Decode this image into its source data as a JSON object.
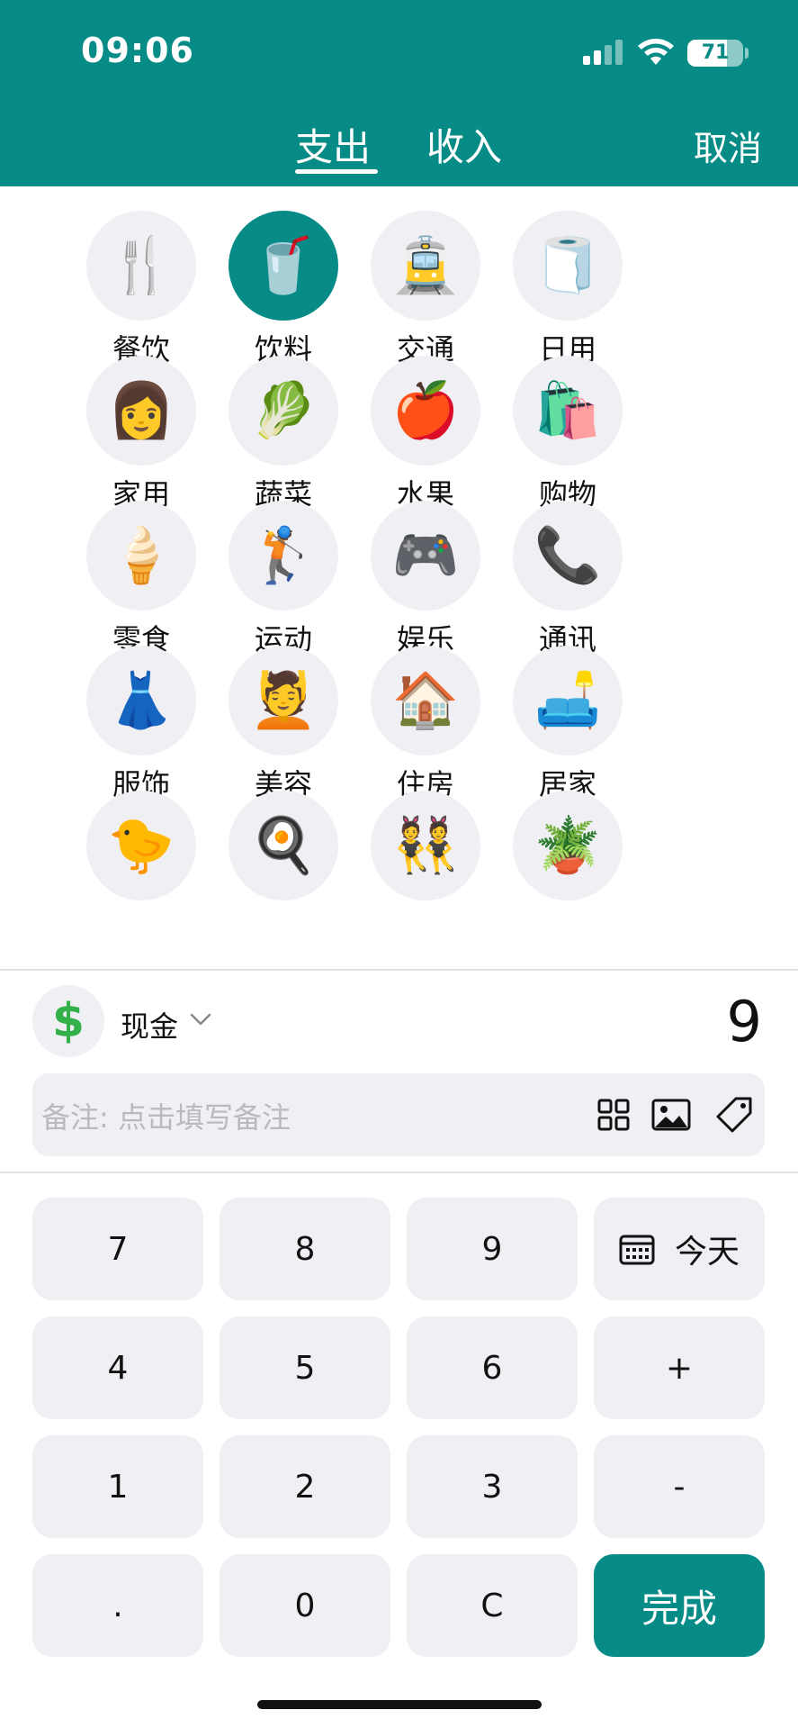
{
  "status_bar": {
    "time": "09:06",
    "battery": "71",
    "battery_level": 0.71
  },
  "header": {
    "tabs": [
      {
        "label": "支出",
        "selected": true
      },
      {
        "label": "收入",
        "selected": false
      }
    ],
    "cancel_label": "取消",
    "color": "#068b86"
  },
  "categories": [
    {
      "label": "餐饮",
      "icon": "fork-and-knife-icon",
      "glyph": "🍴",
      "selected": false
    },
    {
      "label": "饮料",
      "icon": "cup-with-straw-icon",
      "glyph": "🥤",
      "selected": true
    },
    {
      "label": "交通",
      "icon": "tram-icon",
      "glyph": "🚊",
      "selected": false
    },
    {
      "label": "日用",
      "icon": "toilet-paper-icon",
      "glyph": "🧻",
      "selected": false
    },
    {
      "label": "家用",
      "icon": "woman-icon",
      "glyph": "👩",
      "selected": false
    },
    {
      "label": "蔬菜",
      "icon": "leafy-green-icon",
      "glyph": "🥬",
      "selected": false
    },
    {
      "label": "水果",
      "icon": "apple-icon",
      "glyph": "🍎",
      "selected": false
    },
    {
      "label": "购物",
      "icon": "shopping-bags-icon",
      "glyph": "🛍️",
      "selected": false
    },
    {
      "label": "零食",
      "icon": "ice-cream-icon",
      "glyph": "🍦",
      "selected": false
    },
    {
      "label": "运动",
      "icon": "golfer-icon",
      "glyph": "🏌️",
      "selected": false
    },
    {
      "label": "娱乐",
      "icon": "game-controller-icon",
      "glyph": "🎮",
      "selected": false
    },
    {
      "label": "通讯",
      "icon": "telephone-icon",
      "glyph": "📞",
      "selected": false
    },
    {
      "label": "服饰",
      "icon": "dress-icon",
      "glyph": "👗",
      "selected": false
    },
    {
      "label": "美容",
      "icon": "face-massage-icon",
      "glyph": "💆",
      "selected": false
    },
    {
      "label": "住房",
      "icon": "house-icon",
      "glyph": "🏠",
      "selected": false
    },
    {
      "label": "居家",
      "icon": "couch-and-lamp-icon",
      "glyph": "🛋️",
      "selected": false
    },
    {
      "label": "",
      "icon": "partially-hidden-icon",
      "glyph": "🐤",
      "selected": false
    },
    {
      "label": "",
      "icon": "partially-hidden-icon",
      "glyph": "🍳",
      "selected": false
    },
    {
      "label": "",
      "icon": "partially-hidden-icon",
      "glyph": "👯",
      "selected": false
    },
    {
      "label": "",
      "icon": "partially-hidden-icon",
      "glyph": "🪴",
      "selected": false
    }
  ],
  "account": {
    "icon": "dollar-sign-icon",
    "symbol": "$",
    "name": "现金"
  },
  "amount": "9",
  "note": {
    "placeholder": "备注: 点击填写备注"
  },
  "keypad": {
    "rows": [
      [
        "7",
        "8",
        "9",
        "今天"
      ],
      [
        "4",
        "5",
        "6",
        "+"
      ],
      [
        "1",
        "2",
        "3",
        "-"
      ],
      [
        ".",
        "0",
        "C",
        "完成"
      ]
    ]
  }
}
